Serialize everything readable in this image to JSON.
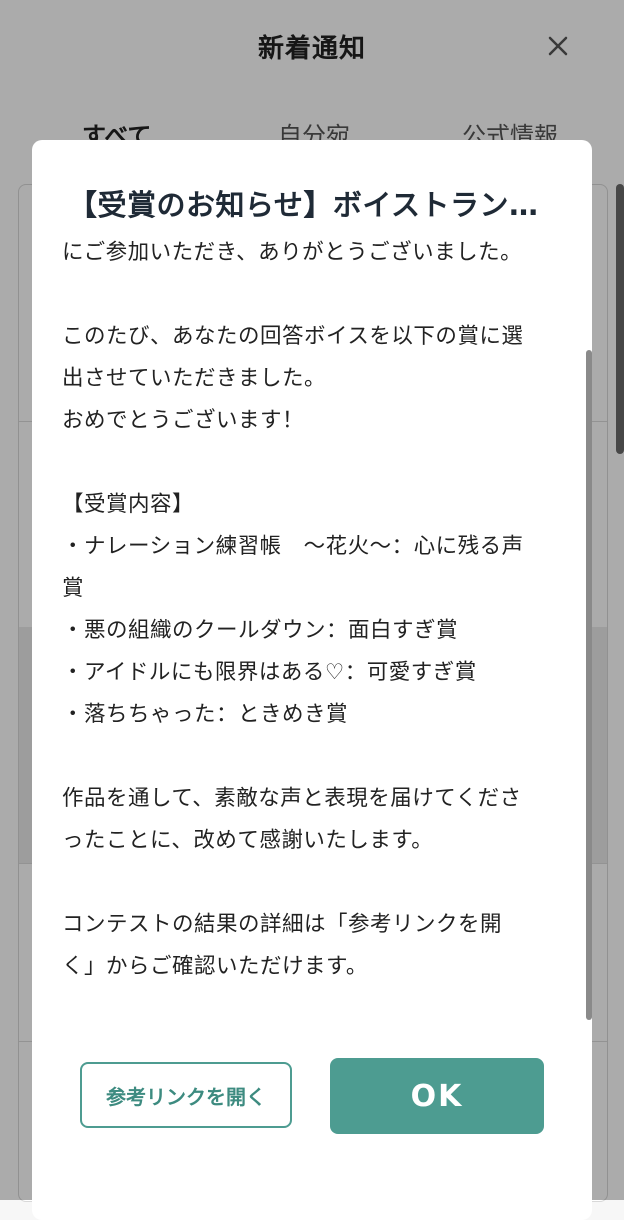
{
  "background": {
    "header_title": "新着通知",
    "tabs": [
      "すべて",
      "自分宛",
      "公式情報"
    ]
  },
  "modal": {
    "title": "【受賞のお知らせ】ボイストラン…",
    "body_lines": [
      "にご参加いただき、ありがとうございました。",
      "",
      "このたび、あなたの回答ボイスを以下の賞に選",
      "出させていただきました。",
      "おめでとうございます！",
      "",
      "【受賞内容】",
      "・ナレーション練習帳　～花火～：心に残る声",
      "賞",
      "・悪の組織のクールダウン：面白すぎ賞",
      "・アイドルにも限界はある♡：可愛すぎ賞",
      "・落ちちゃった：ときめき賞",
      "",
      "作品を通して、素敵な声と表現を届けてくださ",
      "ったことに、改めて感謝いたします。",
      "",
      "コンテストの結果の詳細は「参考リンクを開",
      "く」からご確認いただけます。"
    ]
  },
  "buttons": {
    "open_link_label": "参考リンクを開く",
    "ok_label": "OK"
  },
  "colors": {
    "accent": "#4d9c91",
    "title_text": "#1f2a36"
  },
  "icons": {
    "close": "close-icon"
  }
}
